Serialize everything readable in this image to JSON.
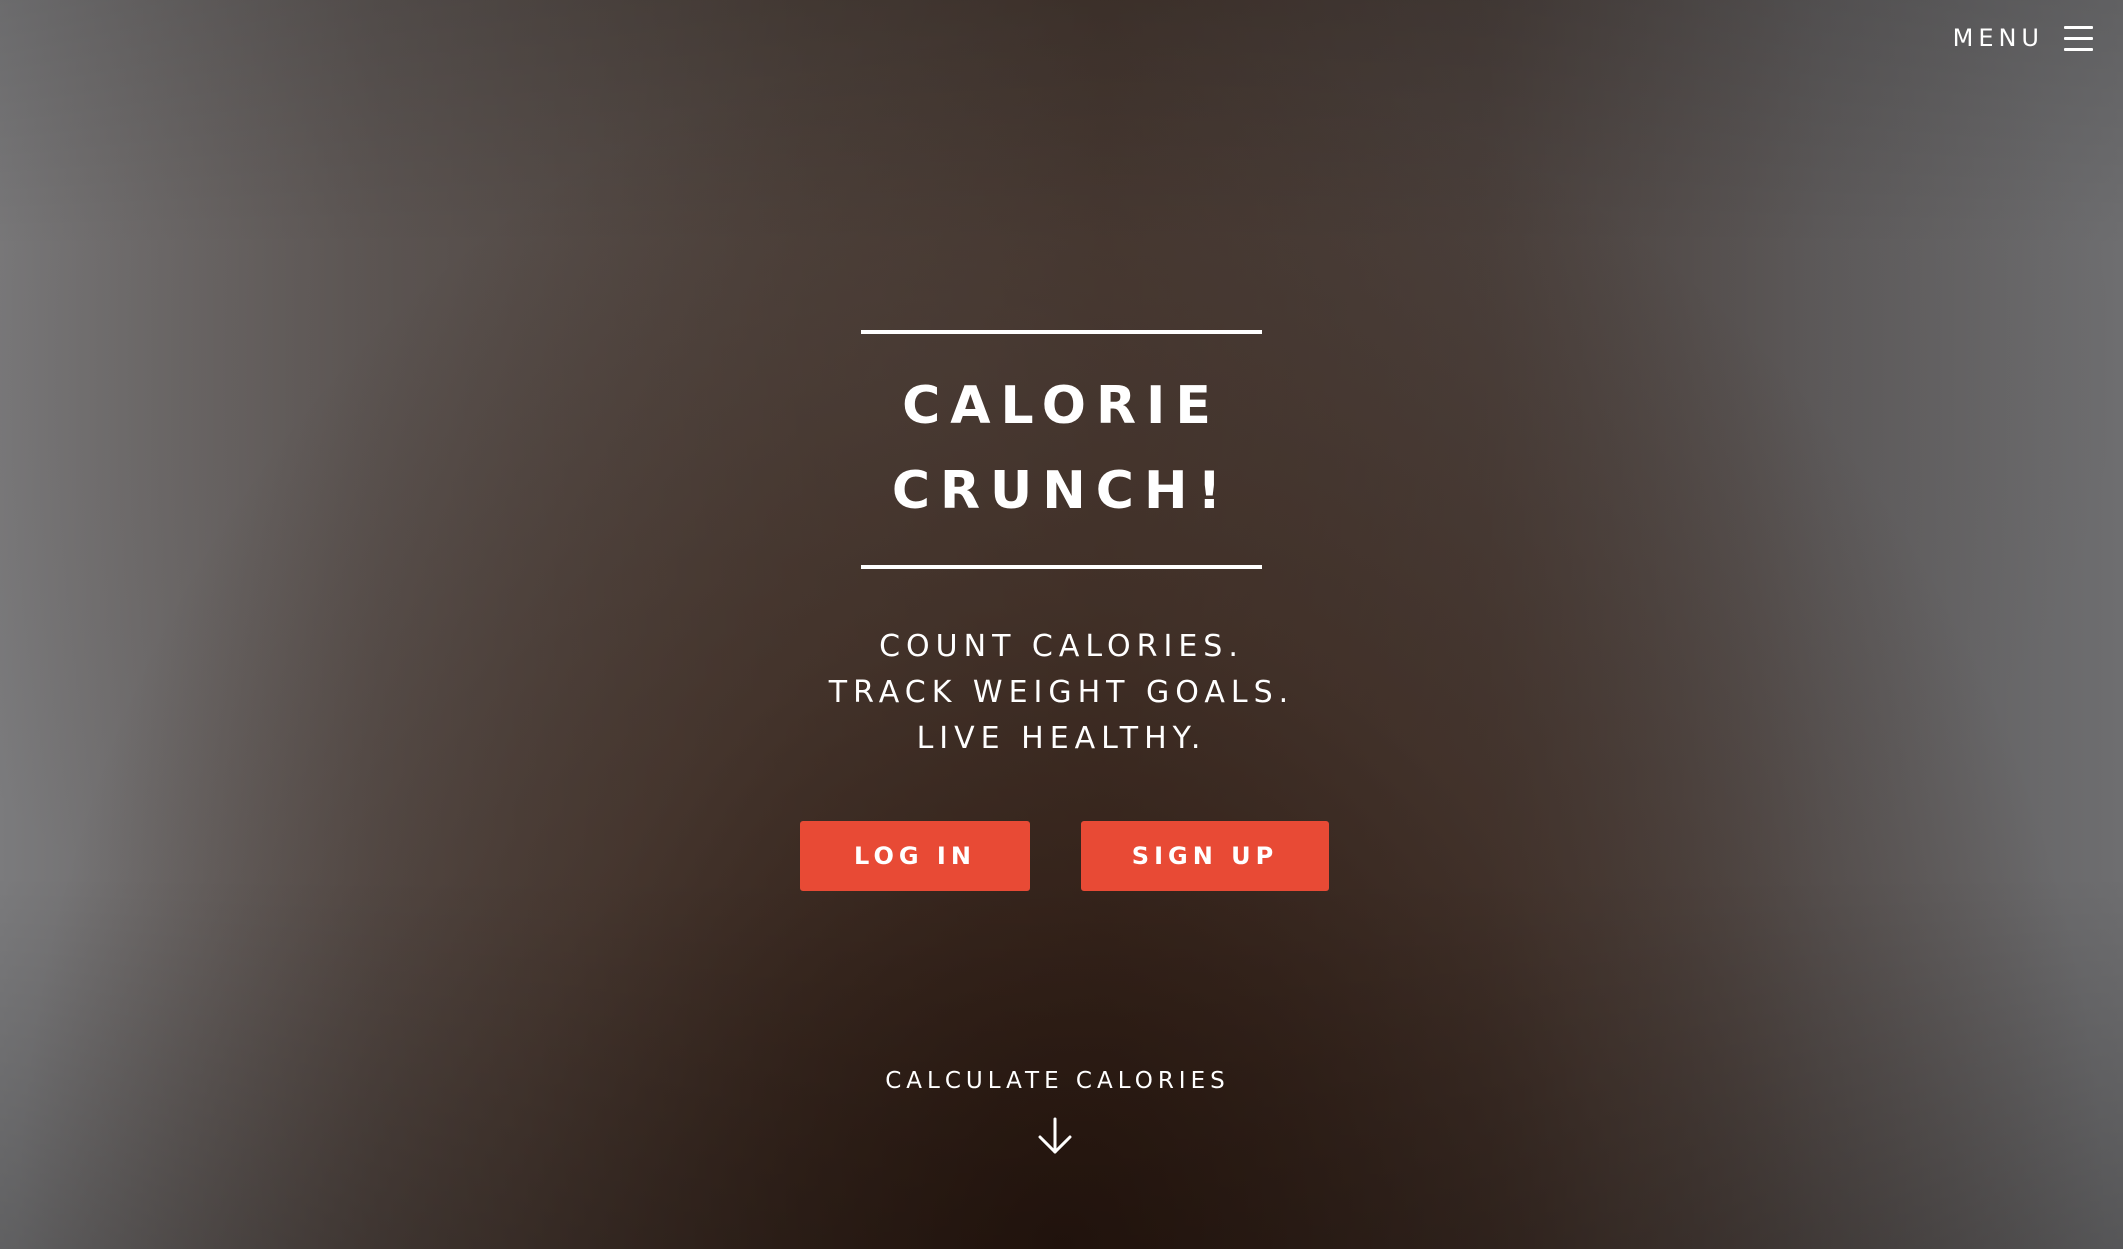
{
  "menu": {
    "label": "MENU",
    "icon": "hamburger-menu-icon"
  },
  "hero": {
    "title_line_1": "CALORIE",
    "title_line_2": "CRUNCH!",
    "tagline": [
      "COUNT CALORIES.",
      "TRACK WEIGHT GOALS.",
      "LIVE HEALTHY."
    ]
  },
  "buttons": {
    "login_label": "LOG IN",
    "signup_label": "SIGN UP"
  },
  "calculate": {
    "label": "CALCULATE CALORIES",
    "icon": "arrow-down-icon"
  },
  "colors": {
    "accent": "#e84a35",
    "text": "#ffffff"
  }
}
